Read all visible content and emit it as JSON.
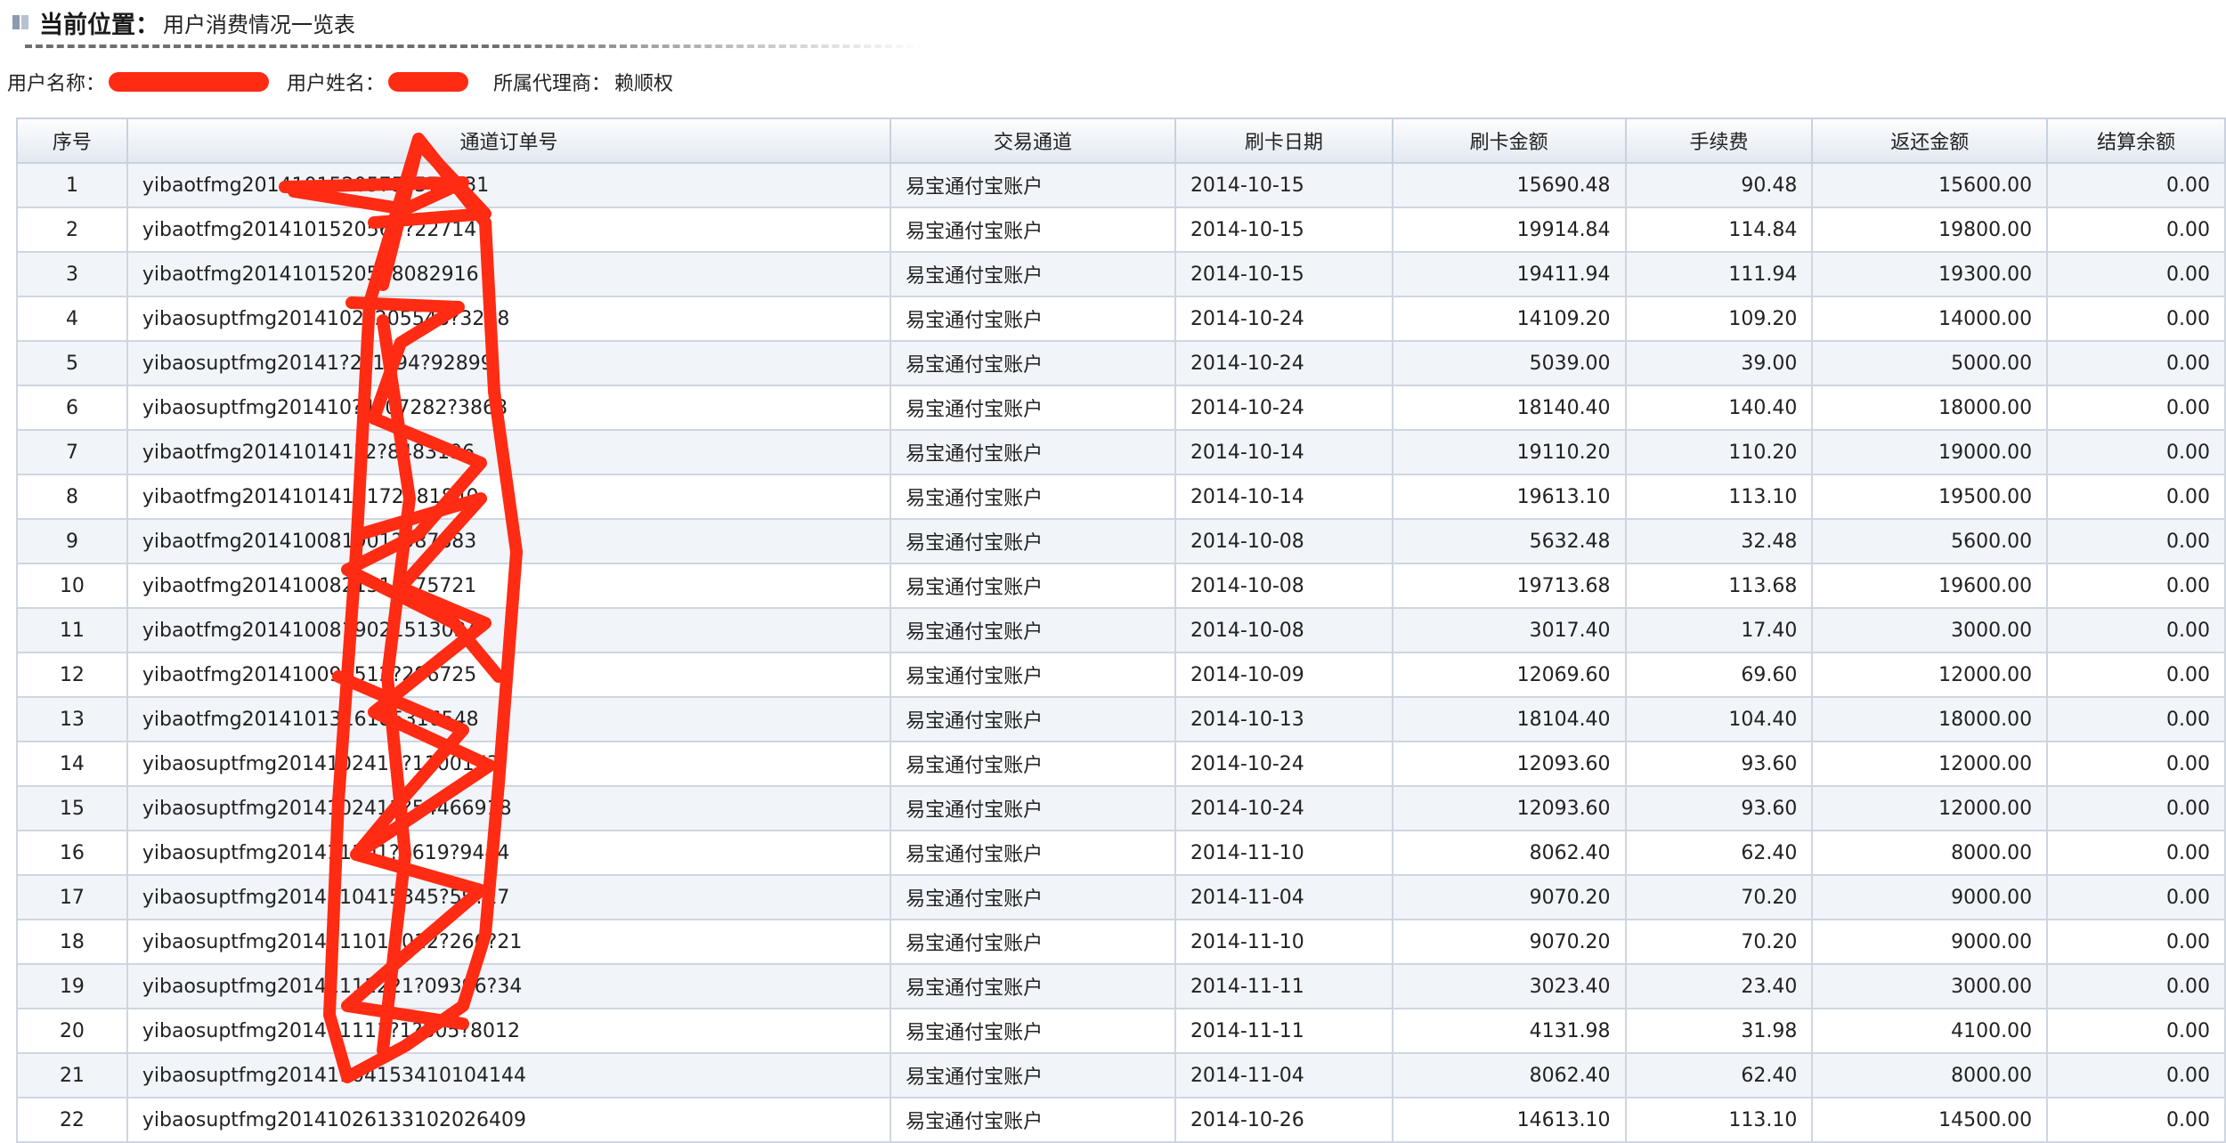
{
  "breadcrumb": {
    "label": "当前位置：",
    "page": "用户消费情况一览表"
  },
  "user_info": {
    "username_label": "用户名称：",
    "realname_label": "用户姓名：",
    "agent_label": "所属代理商：",
    "agent_value": "赖顺权"
  },
  "table": {
    "headers": [
      "序号",
      "通道订单号",
      "交易通道",
      "刷卡日期",
      "刷卡金额",
      "手续费",
      "返还金额",
      "结算余额"
    ],
    "rows": [
      [
        "1",
        "yibaotfmg2014101520575?577831",
        "易宝通付宝账户",
        "2014-10-15",
        "15690.48",
        "90.48",
        "15600.00",
        "0.00"
      ],
      [
        "2",
        "yibaotfmg2014101520562?22714",
        "易宝通付宝账户",
        "2014-10-15",
        "19914.84",
        "114.84",
        "19800.00",
        "0.00"
      ],
      [
        "3",
        "yibaotfmg2014101520598082916",
        "易宝通付宝账户",
        "2014-10-15",
        "19411.94",
        "111.94",
        "19300.00",
        "0.00"
      ],
      [
        "4",
        "yibaosuptfmg2014102?205548?3248",
        "易宝通付宝账户",
        "2014-10-24",
        "14109.20",
        "109.20",
        "14000.00",
        "0.00"
      ],
      [
        "5",
        "yibaosuptfmg20141?2?1?94?92899",
        "易宝通付宝账户",
        "2014-10-24",
        "5039.00",
        "39.00",
        "5000.00",
        "0.00"
      ],
      [
        "6",
        "yibaosuptfmg201410?4?07282?3868",
        "易宝通付宝账户",
        "2014-10-24",
        "18140.40",
        "140.40",
        "18000.00",
        "0.00"
      ],
      [
        "7",
        "yibaotfmg201410141?2?8483196",
        "易宝通付宝账户",
        "2014-10-14",
        "19110.20",
        "110.20",
        "19000.00",
        "0.00"
      ],
      [
        "8",
        "yibaotfmg2014101419172281840",
        "易宝通付宝账户",
        "2014-10-14",
        "19613.10",
        "113.10",
        "19500.00",
        "0.00"
      ],
      [
        "9",
        "yibaotfmg201410081901?587883",
        "易宝通付宝账户",
        "2014-10-08",
        "5632.48",
        "32.48",
        "5600.00",
        "0.00"
      ],
      [
        "10",
        "yibaotfmg2014100821311?75721",
        "易宝通付宝账户",
        "2014-10-08",
        "19713.68",
        "113.68",
        "19600.00",
        "0.00"
      ],
      [
        "11",
        "yibaotfmg2014100819021513034",
        "易宝通付宝账户",
        "2014-10-08",
        "3017.40",
        "17.40",
        "3000.00",
        "0.00"
      ],
      [
        "12",
        "yibaotfmg201410092512?296725",
        "易宝通付宝账户",
        "2014-10-09",
        "12069.60",
        "69.60",
        "12000.00",
        "0.00"
      ],
      [
        "13",
        "yibaotfmg2014101316185316548",
        "易宝通付宝账户",
        "2014-10-13",
        "18104.40",
        "104.40",
        "18000.00",
        "0.00"
      ],
      [
        "14",
        "yibaosuptfmg2014102411?1100173",
        "易宝通付宝账户",
        "2014-10-24",
        "12093.60",
        "93.60",
        "12000.00",
        "0.00"
      ],
      [
        "15",
        "yibaosuptfmg2014102411?54466918",
        "易宝通付宝账户",
        "2014-10-24",
        "12093.60",
        "93.60",
        "12000.00",
        "0.00"
      ],
      [
        "16",
        "yibaosuptfmg201411101?5619?9444",
        "易宝通付宝账户",
        "2014-11-10",
        "8062.40",
        "62.40",
        "8000.00",
        "0.00"
      ],
      [
        "17",
        "yibaosuptfmg2014110415345?59?17",
        "易宝通付宝账户",
        "2014-11-04",
        "9070.20",
        "70.20",
        "9000.00",
        "0.00"
      ],
      [
        "18",
        "yibaosuptfmg2014111018012?266?21",
        "易宝通付宝账户",
        "2014-11-10",
        "9070.20",
        "70.20",
        "9000.00",
        "0.00"
      ],
      [
        "19",
        "yibaosuptfmg20141111221?09396?34",
        "易宝通付宝账户",
        "2014-11-11",
        "3023.40",
        "23.40",
        "3000.00",
        "0.00"
      ],
      [
        "20",
        "yibaosuptfmg201411111?1?805?8012",
        "易宝通付宝账户",
        "2014-11-11",
        "4131.98",
        "31.98",
        "4100.00",
        "0.00"
      ],
      [
        "21",
        "yibaosuptfmg20141104153410104144",
        "易宝通付宝账户",
        "2014-11-04",
        "8062.40",
        "62.40",
        "8000.00",
        "0.00"
      ],
      [
        "22",
        "yibaosuptfmg20141026133102026409",
        "易宝通付宝账户",
        "2014-10-26",
        "14613.10",
        "113.10",
        "14500.00",
        "0.00"
      ]
    ]
  },
  "colors": {
    "redaction": "#ff2b13",
    "header_bg": "#e3e9f1",
    "row_alt": "#f1f4f9",
    "border": "#cfd6e0"
  }
}
